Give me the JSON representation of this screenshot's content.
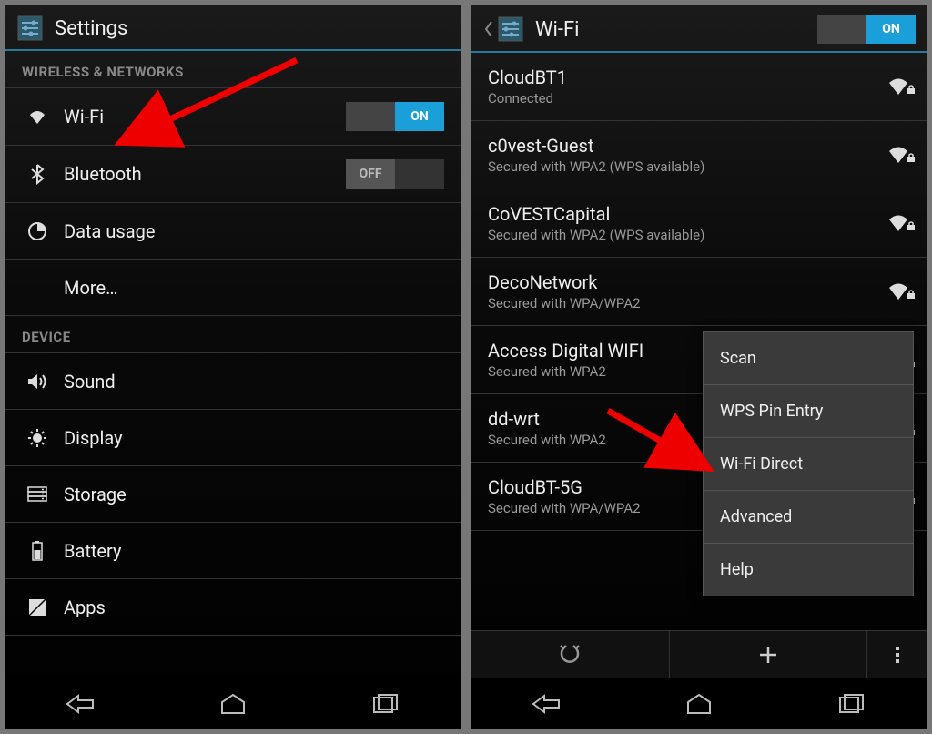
{
  "left": {
    "title": "Settings",
    "sections": {
      "wireless_header": "WIRELESS & NETWORKS",
      "device_header": "DEVICE"
    },
    "items": {
      "wifi": {
        "label": "Wi-Fi",
        "toggle": "ON"
      },
      "bluetooth": {
        "label": "Bluetooth",
        "toggle": "OFF"
      },
      "data_usage": {
        "label": "Data usage"
      },
      "more": {
        "label": "More…"
      },
      "sound": {
        "label": "Sound"
      },
      "display": {
        "label": "Display"
      },
      "storage": {
        "label": "Storage"
      },
      "battery": {
        "label": "Battery"
      },
      "apps": {
        "label": "Apps"
      }
    }
  },
  "right": {
    "title": "Wi-Fi",
    "toggle": "ON",
    "networks": [
      {
        "name": "CloudBT1",
        "status": "Connected"
      },
      {
        "name": "c0vest-Guest",
        "status": "Secured with WPA2 (WPS available)"
      },
      {
        "name": "CoVESTCapital",
        "status": "Secured with WPA2 (WPS available)"
      },
      {
        "name": "DecoNetwork",
        "status": "Secured with WPA/WPA2"
      },
      {
        "name": "Access Digital WIFI",
        "status": "Secured with WPA2"
      },
      {
        "name": "dd-wrt",
        "status": "Secured with WPA2"
      },
      {
        "name": "CloudBT-5G",
        "status": "Secured with WPA/WPA2"
      }
    ],
    "menu": [
      "Scan",
      "WPS Pin Entry",
      "Wi-Fi Direct",
      "Advanced",
      "Help"
    ]
  }
}
